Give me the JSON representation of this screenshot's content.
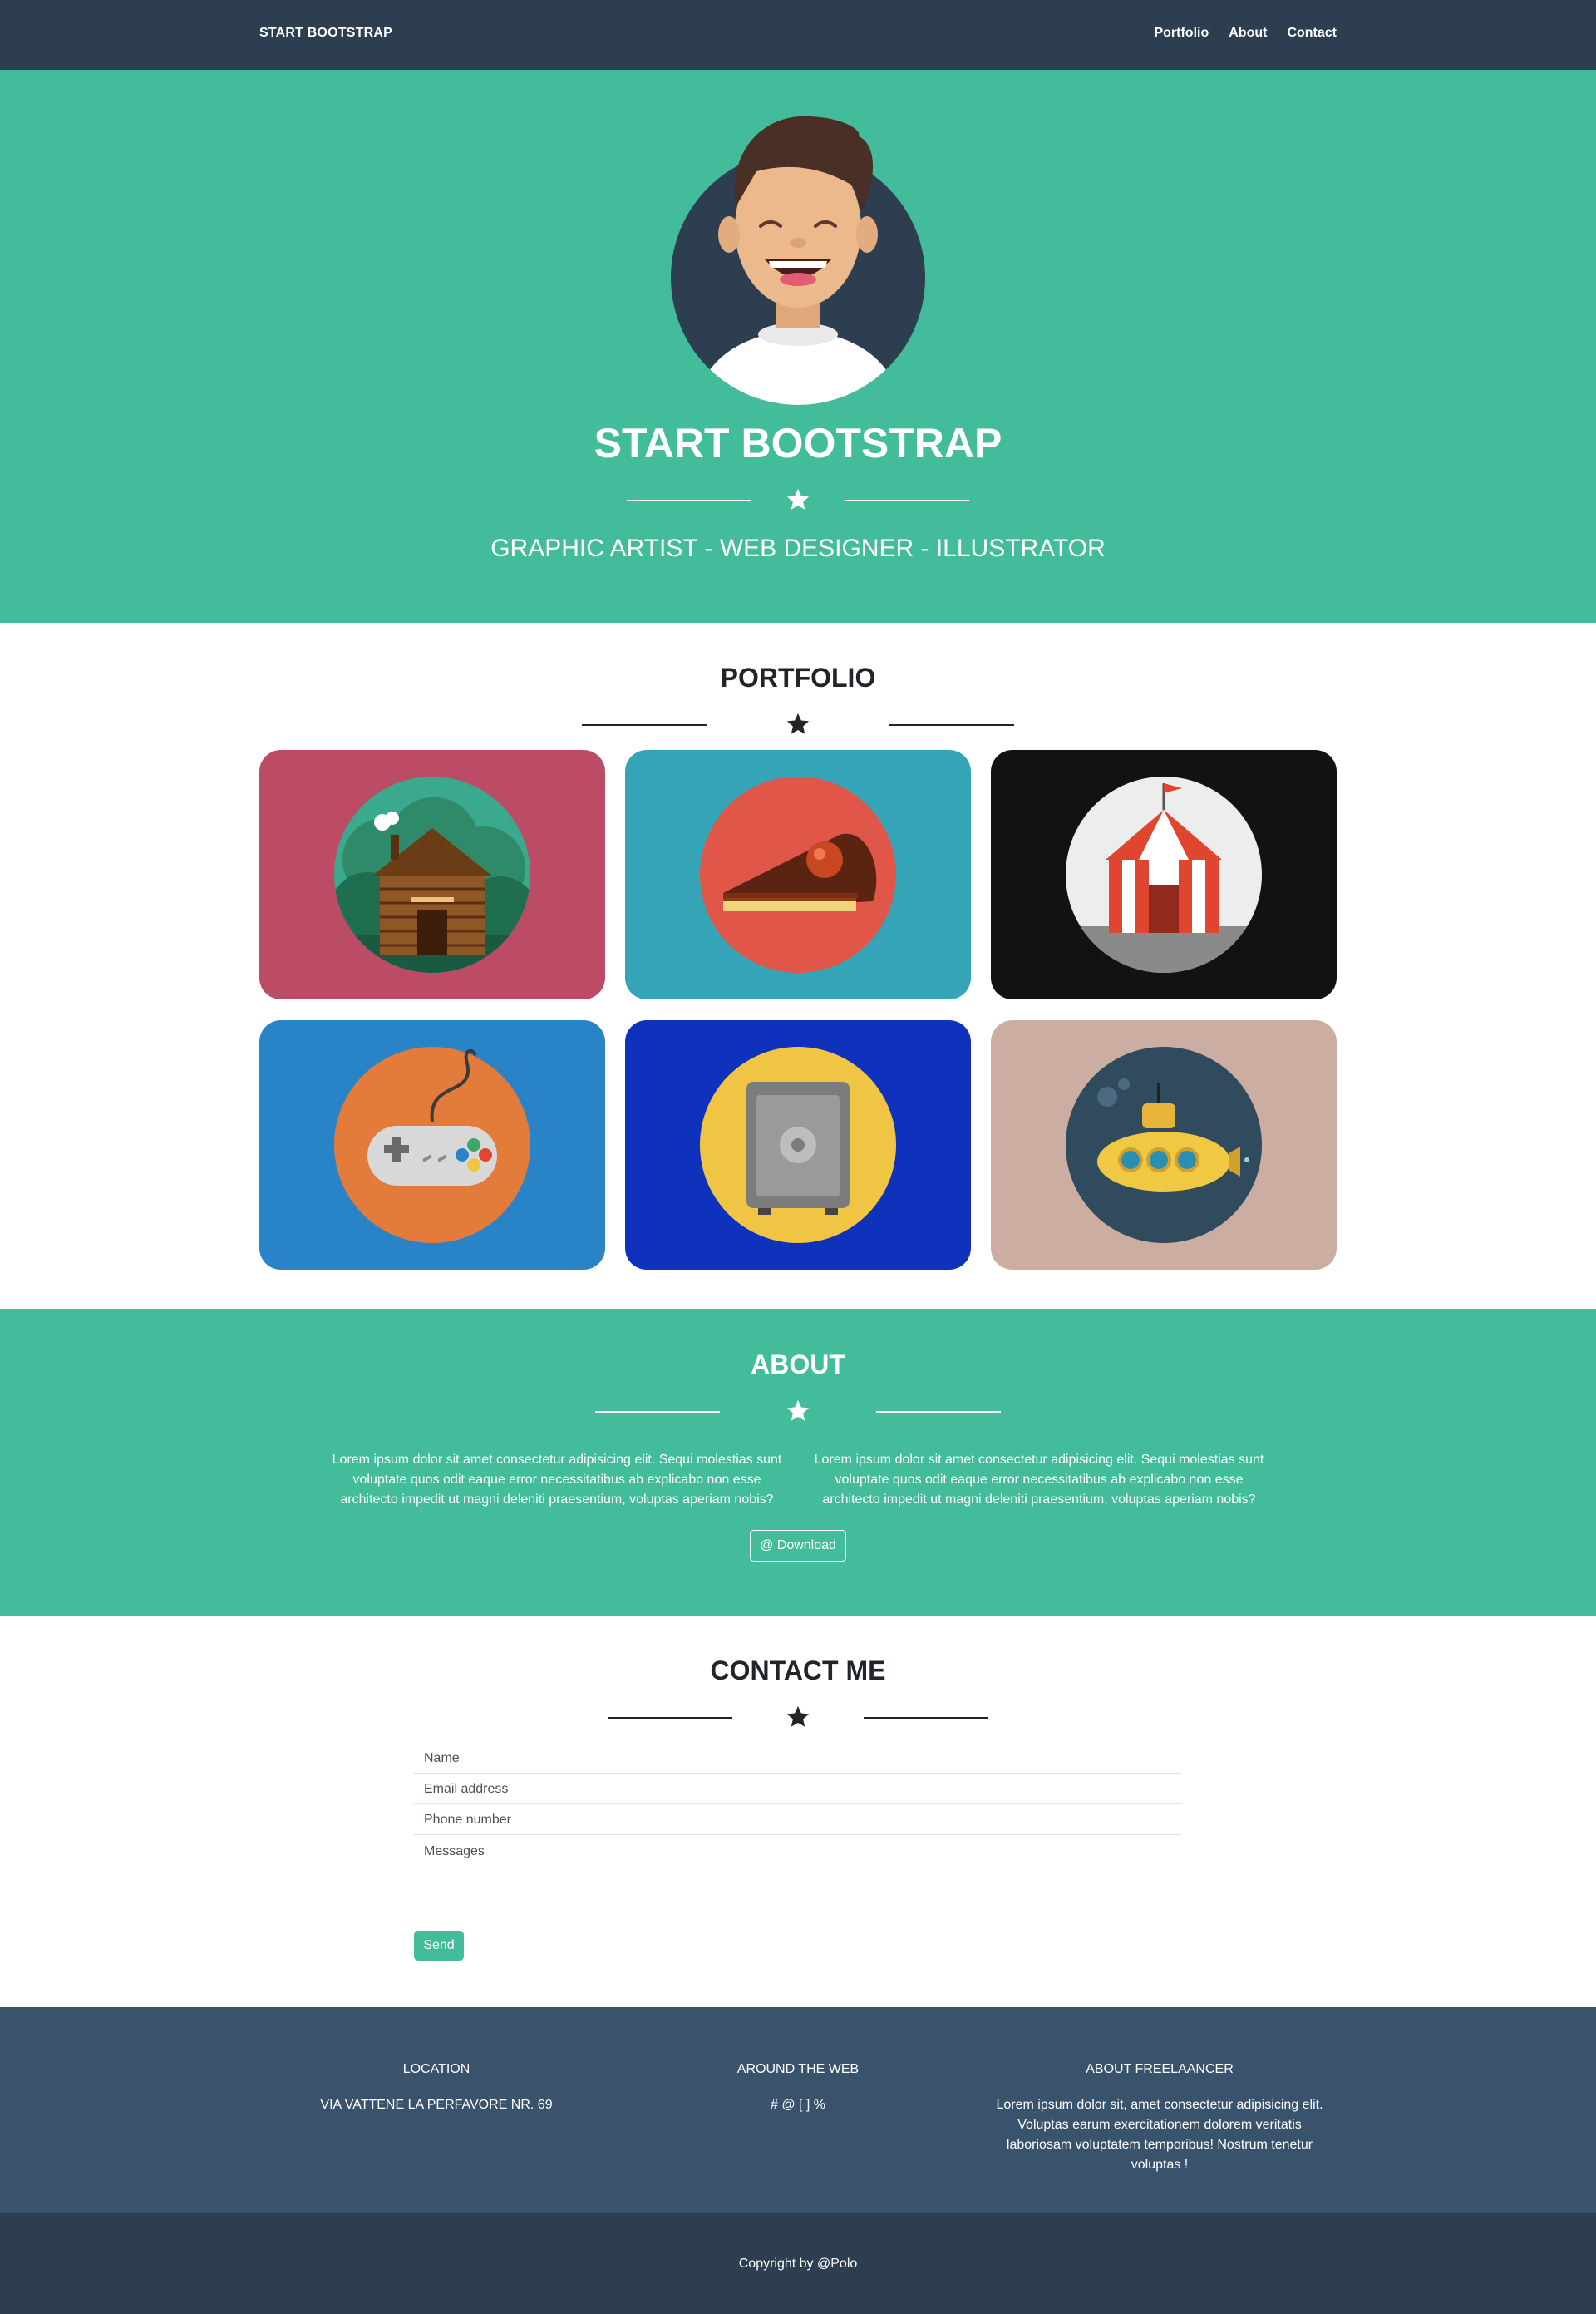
{
  "navbar": {
    "brand": "START BOOTSTRAP",
    "links": [
      "Portfolio",
      "About",
      "Contact"
    ]
  },
  "hero": {
    "title": "START BOOTSTRAP",
    "subtitle": "GRAPHIC ARTIST - WEB DESIGNER - ILLUSTRATOR"
  },
  "portfolio": {
    "title": "PORTFOLIO",
    "items": [
      {
        "icon": "cabin-icon",
        "bg": "#bc4c65",
        "circle": "#3aa98d"
      },
      {
        "icon": "cake-icon",
        "bg": "#36a4b7",
        "circle": "#e0574a"
      },
      {
        "icon": "circus-tent-icon",
        "bg": "#141111",
        "circle": "#eceeee"
      },
      {
        "icon": "game-controller-icon",
        "bg": "#2884c6",
        "circle": "#e37b3b"
      },
      {
        "icon": "safe-icon",
        "bg": "#0f32bd",
        "circle": "#efc543"
      },
      {
        "icon": "submarine-icon",
        "bg": "#cbada1",
        "circle": "#2f4b5d"
      }
    ]
  },
  "about": {
    "title": "ABOUT",
    "col1": "Lorem ipsum dolor sit amet consectetur adipisicing elit. Sequi molestias sunt voluptate quos odit eaque error necessitatibus ab explicabo non esse architecto impedit ut magni deleniti praesentium, voluptas aperiam nobis?",
    "col2": "Lorem ipsum dolor sit amet consectetur adipisicing elit. Sequi molestias sunt voluptate quos odit eaque error necessitatibus ab explicabo non esse architecto impedit ut magni deleniti praesentium, voluptas aperiam nobis?",
    "download_label": "@ Download"
  },
  "contact": {
    "title": "CONTACT ME",
    "name_placeholder": "Name",
    "email_placeholder": "Email address",
    "phone_placeholder": "Phone number",
    "message_placeholder": "Messages",
    "send_label": "Send"
  },
  "footer": {
    "location_title": "LOCATION",
    "location_text": "VIA VATTENE LA PERFAVORE NR. 69",
    "web_title": "AROUND THE WEB",
    "web_text": "# @ [ ] %",
    "about_title": "ABOUT FREELAANCER",
    "about_text": "Lorem ipsum dolor sit, amet consectetur adipisicing elit. Voluptas earum exercitationem dolorem veritatis laboriosam voluptatem temporibus! Nostrum tenetur voluptas !",
    "copyright": "Copyright by @Polo"
  },
  "colors": {
    "primary": "#42bc9b",
    "navbar": "#2c3e50",
    "footer": "#3a536d"
  }
}
